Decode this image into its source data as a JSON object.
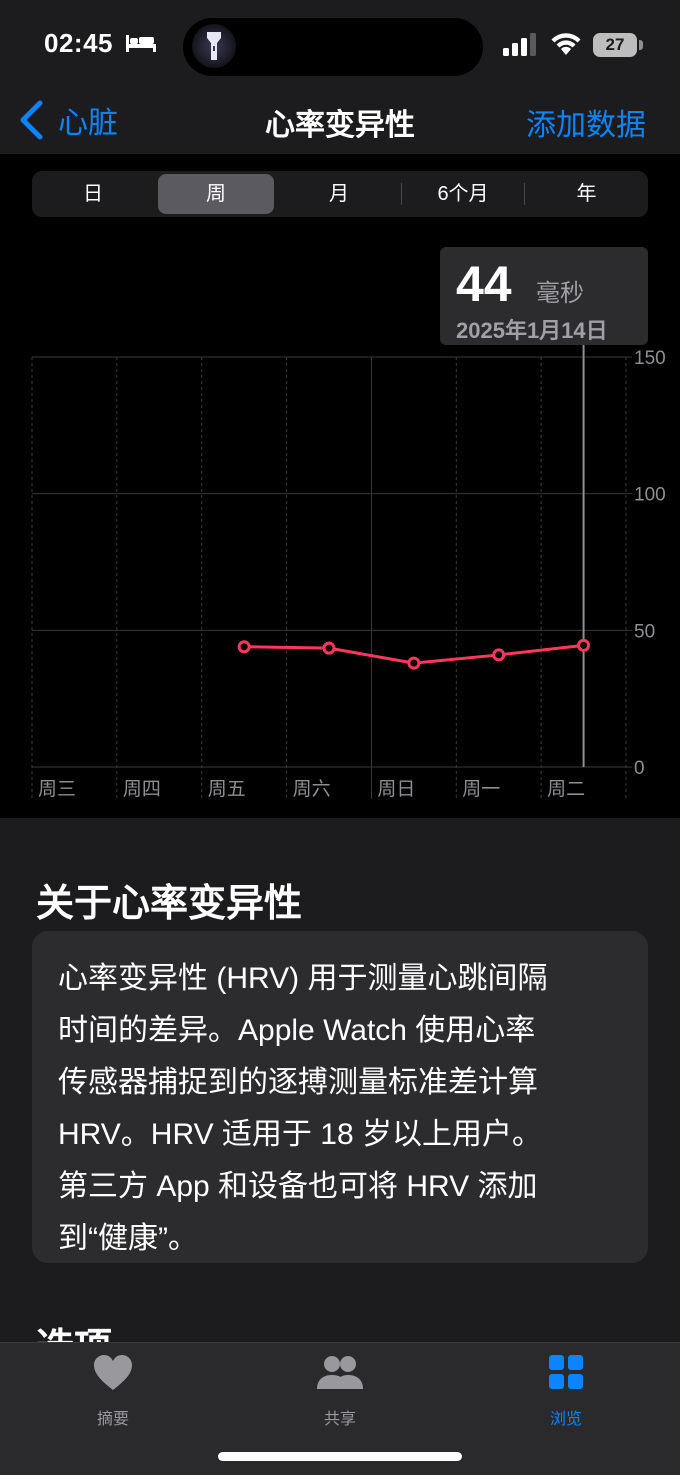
{
  "status": {
    "time": "02:45",
    "battery": "27"
  },
  "nav": {
    "back_label": "心脏",
    "title": "心率变异性",
    "add_label": "添加数据"
  },
  "segments": [
    {
      "label": "日",
      "active": false
    },
    {
      "label": "周",
      "active": true
    },
    {
      "label": "月",
      "active": false
    },
    {
      "label": "6个月",
      "active": false
    },
    {
      "label": "年",
      "active": false
    }
  ],
  "tooltip": {
    "value": "44",
    "unit": "毫秒",
    "date": "2025年1月14日"
  },
  "chart_data": {
    "type": "line",
    "categories": [
      "周三",
      "周四",
      "周五",
      "周六",
      "周日",
      "周一",
      "周二"
    ],
    "series": [
      {
        "values": [
          null,
          null,
          44,
          43.5,
          38,
          41,
          44.5
        ],
        "color": "#ff375f"
      }
    ],
    "y_ticks": [
      "0",
      "50",
      "100",
      "150"
    ],
    "ylim": [
      0,
      150
    ],
    "selected_index": 6,
    "grid": true
  },
  "about": {
    "title": "关于心率变异性",
    "lines": [
      "心率变异性 (HRV) 用于测量心跳间隔",
      "时间的差异。Apple Watch 使用心率",
      "传感器捕捉到的逐搏测量标准差计算",
      "HRV。HRV 适用于 18 岁以上用户。",
      "第三方 App 和设备也可将 HRV 添加",
      "到“健康”。"
    ]
  },
  "options_title": "选项",
  "tabs": [
    {
      "label": "摘要",
      "icon": "heart-icon",
      "active": false
    },
    {
      "label": "共享",
      "icon": "people-icon",
      "active": false
    },
    {
      "label": "浏览",
      "icon": "grid-icon",
      "active": true
    }
  ],
  "colors": {
    "accent": "#0a84ff",
    "line": "#ff375f"
  }
}
